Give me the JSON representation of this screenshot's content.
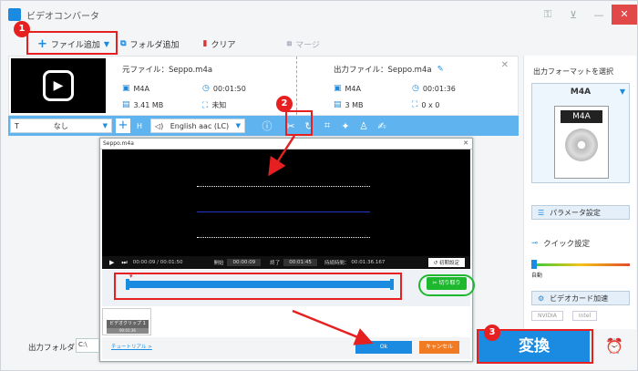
{
  "app": {
    "title": "ビデオコンバータ"
  },
  "toolbar": {
    "add_file": "ファイル追加",
    "add_folder": "フォルダ追加",
    "clear": "クリア",
    "merge": "マージ"
  },
  "file": {
    "source_label": "元ファイル：Seppo.m4a",
    "source_format": "M4A",
    "source_duration": "00:01:50",
    "source_size": "3.41 MB",
    "source_res": "未知",
    "output_label": "出力ファイル：Seppo.m4a",
    "output_format": "M4A",
    "output_duration": "00:01:36",
    "output_size": "3 MB",
    "output_res": "0 x 0"
  },
  "editbar": {
    "subtitle": "なし",
    "audio_track": "English aac (LC)"
  },
  "dialog": {
    "title": "Seppo.m4a",
    "time": "00:00:09 / 00:01:50",
    "start_label": "開始",
    "start_value": "00:00:09",
    "end_label": "終了",
    "end_value": "00:01:45",
    "dur_label": "持続時間：",
    "dur_value": "00:01:36.167",
    "reset": "初期設定",
    "cut": "切り取り",
    "clip_label": "ビデオクリップ 1",
    "clip_dur": "00:01:36",
    "tutorial": "チュートリアル >",
    "ok": "Ok",
    "cancel": "キャンセル"
  },
  "output": {
    "folder_label": "出力フォルダ：",
    "folder_value": "C:\\"
  },
  "right": {
    "title": "出力フォーマットを選択",
    "format": "M4A",
    "format_tag": "M4A",
    "param": "パラメータ設定",
    "quick": "クイック設定",
    "auto": "自動",
    "gpu": "ビデオカード加速",
    "nvidia": "NVIDIA",
    "intel": "Intel"
  },
  "convert": "変換",
  "badges": {
    "one": "1",
    "two": "2",
    "three": "3"
  }
}
